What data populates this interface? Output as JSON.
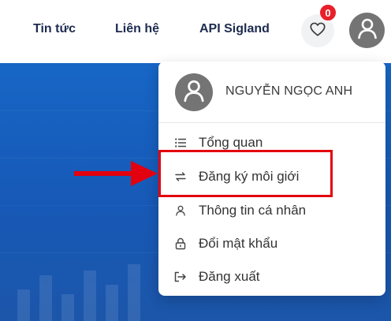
{
  "nav": {
    "links": [
      "Tin tức",
      "Liên hệ",
      "API Sigland"
    ],
    "favorites_count": "0"
  },
  "user": {
    "name": "NGUYỄN NGỌC ANH"
  },
  "menu": {
    "items": [
      {
        "label": "Tổng quan",
        "icon": "list-icon"
      },
      {
        "label": "Đăng ký môi giới",
        "icon": "swap-icon"
      },
      {
        "label": "Thông tin cá nhân",
        "icon": "user-icon"
      },
      {
        "label": "Đổi mật khẩu",
        "icon": "lock-icon"
      },
      {
        "label": "Đăng xuất",
        "icon": "logout-icon"
      }
    ]
  },
  "colors": {
    "nav_text": "#1d2b4f",
    "badge": "#e8202a",
    "banner": "#1766c6",
    "annotation": "#e3000f"
  }
}
